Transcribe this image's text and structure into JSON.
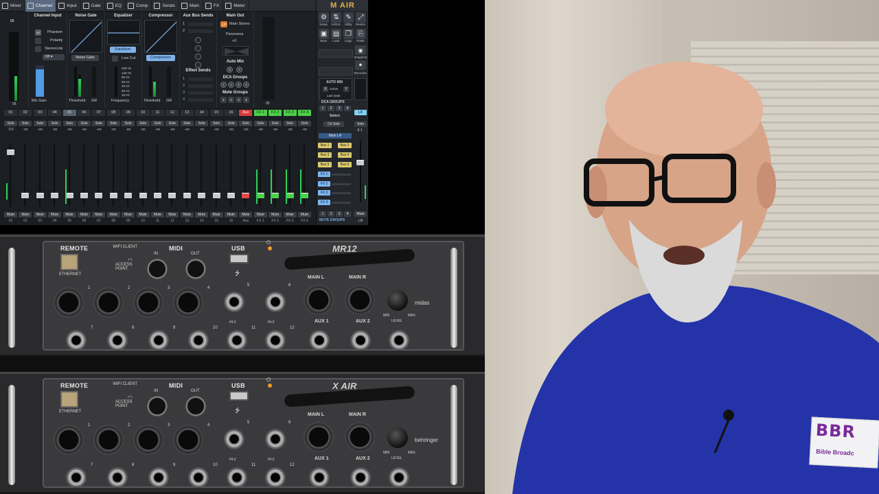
{
  "app": {
    "tabs": [
      "Mixer",
      "Channel",
      "Input",
      "Gate",
      "EQ",
      "Comp",
      "Sends",
      "Main",
      "FX",
      "Meter"
    ],
    "active_tab": "Channel",
    "logo": "M AIR"
  },
  "channel_input": {
    "title": "Channel Input",
    "phantom": "Phantom",
    "polarity": "Polarity",
    "stereo_link": "StereoLink",
    "off": "Off",
    "mic_gain": "Mic Gain",
    "ch_label": "05",
    "ch_foot": "05"
  },
  "noise_gate": {
    "title": "Noise Gate",
    "button": "Noise Gate",
    "threshold": "Threshold",
    "gr": "GR"
  },
  "equalizer": {
    "title": "Equalizer",
    "button": "Equalizer",
    "low_cut": "Low Cut",
    "frequency": "Frequency",
    "freqs": [
      "230 Hz",
      "140 Hz",
      "90 Hz",
      "60 Hz",
      "40 Hz",
      "25 Hz",
      "16 Hz"
    ]
  },
  "compressor": {
    "title": "Compressor",
    "button": "Compressor",
    "threshold": "Threshold",
    "gr": "GR"
  },
  "aux_bus_sends": {
    "title": "Aux Bus Sends",
    "rows": [
      "1",
      "2"
    ],
    "effect_sends": "Effect Sends",
    "effects": [
      "1",
      "2",
      "3",
      "4"
    ]
  },
  "main_out": {
    "title": "Main Out",
    "lr": "LR",
    "main_stereo": "Main Stereo",
    "panorama": "Panorama",
    "pan_value": "+0",
    "auto_mix": "Auto Mix",
    "auto_mix_buttons": [
      "X",
      "Y"
    ],
    "dca_groups": "DCA Groups",
    "dca_buttons": [
      "1",
      "2",
      "3",
      "4"
    ],
    "mute_groups": "Mute Groups",
    "mute_buttons": [
      "1",
      "2",
      "3",
      "4"
    ]
  },
  "main_meter_foot": "05",
  "strips": [
    {
      "num": "01",
      "val": "-0.5",
      "foot": "01",
      "fader": 0.12
    },
    {
      "num": "02",
      "val": "-oo",
      "foot": "02",
      "fader": 0.82
    },
    {
      "num": "03",
      "val": "-oo",
      "foot": "03",
      "fader": 0.82
    },
    {
      "num": "04",
      "val": "-oo",
      "foot": "04",
      "fader": 0.82
    },
    {
      "num": "05",
      "val": "-oo",
      "foot": "05",
      "fader": 0.82,
      "selected": true
    },
    {
      "num": "06",
      "val": "-oo",
      "foot": "06",
      "fader": 0.82
    },
    {
      "num": "07",
      "val": "-oo",
      "foot": "07",
      "fader": 0.82
    },
    {
      "num": "08",
      "val": "-oo",
      "foot": "08",
      "fader": 0.82
    },
    {
      "num": "09",
      "val": "-oo",
      "foot": "09",
      "fader": 0.82
    },
    {
      "num": "10",
      "val": "-oo",
      "foot": "10",
      "fader": 0.82
    },
    {
      "num": "11",
      "val": "-oo",
      "foot": "11",
      "fader": 0.82
    },
    {
      "num": "12",
      "val": "-oo",
      "foot": "12",
      "fader": 0.82
    },
    {
      "num": "13",
      "val": "-oo",
      "foot": "13",
      "fader": 0.82
    },
    {
      "num": "14",
      "val": "-oo",
      "foot": "14",
      "fader": 0.82
    },
    {
      "num": "15",
      "val": "-oo",
      "foot": "15",
      "fader": 0.82
    },
    {
      "num": "16",
      "val": "-oo",
      "foot": "16",
      "fader": 0.82
    },
    {
      "num": "Aux",
      "val": "-oo",
      "foot": "Aux",
      "fader": 0.82,
      "kind": "aux"
    },
    {
      "num": "FX 1",
      "val": "-oo",
      "foot": "FX 1",
      "fader": 0.82,
      "kind": "fx"
    },
    {
      "num": "FX 2",
      "val": "-oo",
      "foot": "FX 2",
      "fader": 0.82,
      "kind": "fx"
    },
    {
      "num": "FX 3",
      "val": "-oo",
      "foot": "FX 3",
      "fader": 0.82,
      "kind": "fx"
    },
    {
      "num": "FX 4",
      "val": "-oo",
      "foot": "FX 4",
      "fader": 0.82,
      "kind": "fx"
    }
  ],
  "lr_strip": {
    "num": "LR",
    "val": "-5.1",
    "foot": "LR",
    "fader": 0.35
  },
  "solo_label": "Solo",
  "mute_label": "Mute",
  "right_panel": {
    "buttons": [
      {
        "label": "Setup",
        "icon": "⚙"
      },
      {
        "label": "In/Out",
        "icon": "⇅"
      },
      {
        "label": "Utility",
        "icon": "✎"
      },
      {
        "label": "Resize",
        "icon": "⤢"
      },
      {
        "label": "Save",
        "icon": "▣"
      },
      {
        "label": "Load",
        "icon": "▤"
      },
      {
        "label": "Copy",
        "icon": "❐"
      },
      {
        "label": "Paste",
        "icon": "⎘"
      }
    ],
    "snapshot": "Snapshot",
    "recorder": "Recorder",
    "auto_mix": "AUTO MIX",
    "active": "Active",
    "last_gate": "Last Gate",
    "dca_groups": "DCA GROUPS",
    "dca": [
      "1",
      "2",
      "3",
      "4"
    ],
    "select": "Select",
    "clr_solo": "Clr Solo",
    "solo": "Solo",
    "main_lr": "Main LR",
    "buses": [
      "Bus 1",
      "Bus 2",
      "Bus 3",
      "Bus 4",
      "Bus 5",
      "Bus 6"
    ],
    "fx": [
      "FX 1",
      "FX 2",
      "FX 3",
      "FX 4"
    ],
    "mute_groups_label": "MUTE GROUPS",
    "mute_groups": [
      "1",
      "2",
      "3",
      "4"
    ]
  },
  "hardware": {
    "top": {
      "remote": "REMOTE",
      "wifi_client": "WIFI CLIENT",
      "access_point": "ACCESS POINT",
      "ethernet": "ETHERNET",
      "midi": "MIDI",
      "in": "IN",
      "out": "OUT",
      "usb": "USB",
      "model": "MR12",
      "inputs": [
        "1",
        "2",
        "3",
        "4",
        "5",
        "6",
        "7",
        "8",
        "9",
        "10",
        "11",
        "12"
      ],
      "main_l": "MAIN L",
      "main_r": "MAIN R",
      "aux1": "AUX 1",
      "aux2": "AUX 2",
      "min": "MIN",
      "max": "MAX",
      "level": "LEVEL",
      "brand": "midas",
      "hiz": "HI-Z"
    },
    "bottom": {
      "remote": "REMOTE",
      "wifi_client": "WIFI CLIENT",
      "access_point": "ACCESS POINT",
      "ethernet": "ETHERNET",
      "midi": "MIDI",
      "in": "IN",
      "out": "OUT",
      "usb": "USB",
      "model": "X AIR",
      "inputs": [
        "1",
        "2",
        "3",
        "4",
        "5",
        "6",
        "7",
        "8",
        "9",
        "10",
        "11",
        "12"
      ],
      "main_l": "MAIN L",
      "main_r": "MAIN R",
      "aux1": "AUX 1",
      "aux2": "AUX 2",
      "min": "MIN",
      "max": "MAX",
      "level": "LEVEL",
      "brand": "behringer",
      "hiz": "HI-Z"
    }
  },
  "webcam": {
    "sticker_big": "BBR",
    "sticker_small": "Bible Broadc"
  }
}
